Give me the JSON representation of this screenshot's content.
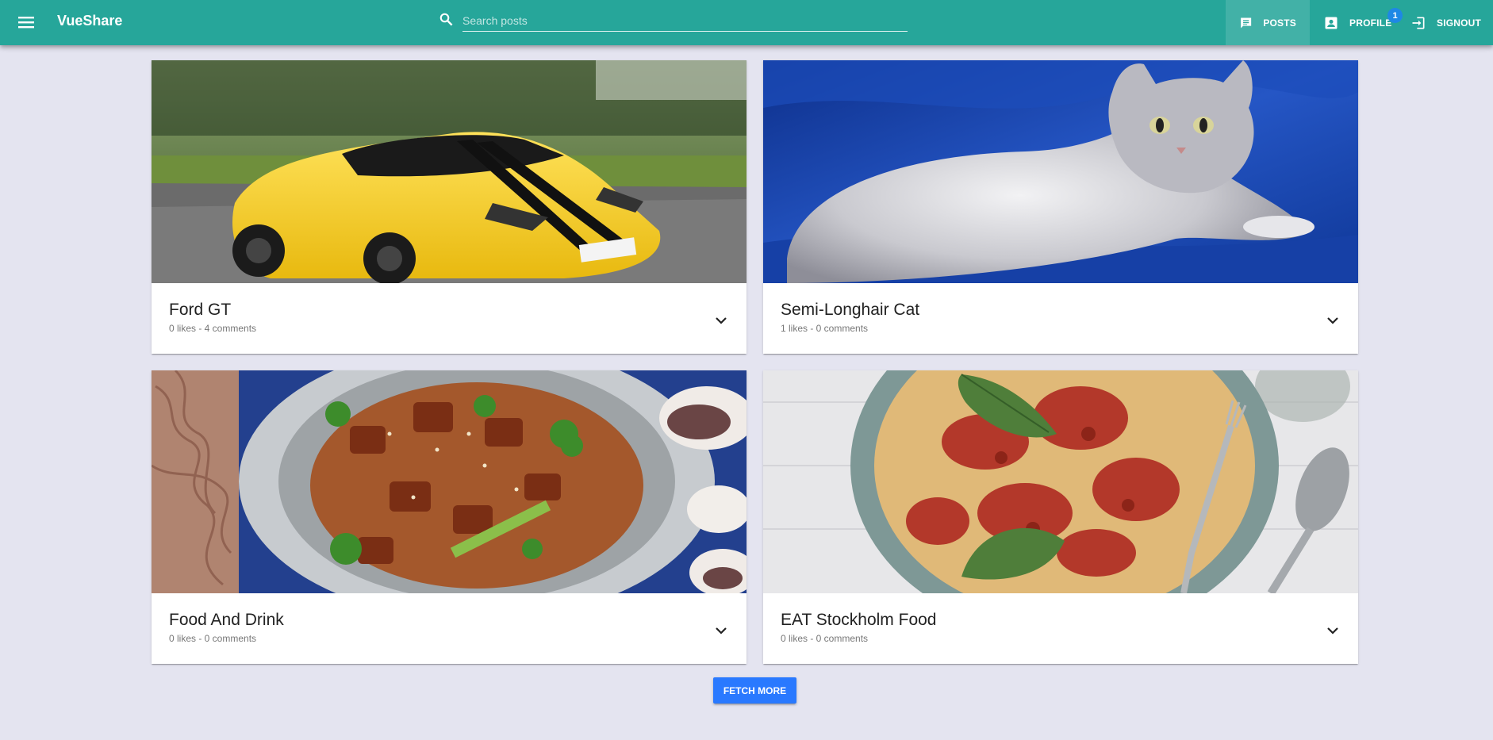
{
  "app": {
    "title": "VueShare"
  },
  "search": {
    "placeholder": "Search posts",
    "value": ""
  },
  "nav": {
    "posts_label": "POSTS",
    "profile_label": "PROFILE",
    "profile_badge": "1",
    "signout_label": "SIGNOUT"
  },
  "colors": {
    "toolbar": "#26a69a",
    "badge": "#1e88e5",
    "fetch_button": "#2979ff",
    "background": "#e4e4f0"
  },
  "posts": [
    {
      "title": "Ford GT",
      "meta": "0 likes - 4 comments",
      "image": "yellow-sports-car"
    },
    {
      "title": "Semi-Longhair Cat",
      "meta": "1 likes - 0 comments",
      "image": "grey-longhair-cat-on-blue-cloth"
    },
    {
      "title": "Food And Drink",
      "meta": "0 likes - 0 comments",
      "image": "noodle-stir-fry-plate"
    },
    {
      "title": "EAT Stockholm Food",
      "meta": "0 likes - 0 comments",
      "image": "pasta-with-tomato-sauce-bowl"
    }
  ],
  "fetch_more_label": "FETCH MORE",
  "icons": {
    "menu": "menu-icon",
    "search": "search-icon",
    "posts": "chat-icon",
    "profile": "account-box-icon",
    "signout": "exit-icon",
    "expand": "chevron-down-icon"
  }
}
